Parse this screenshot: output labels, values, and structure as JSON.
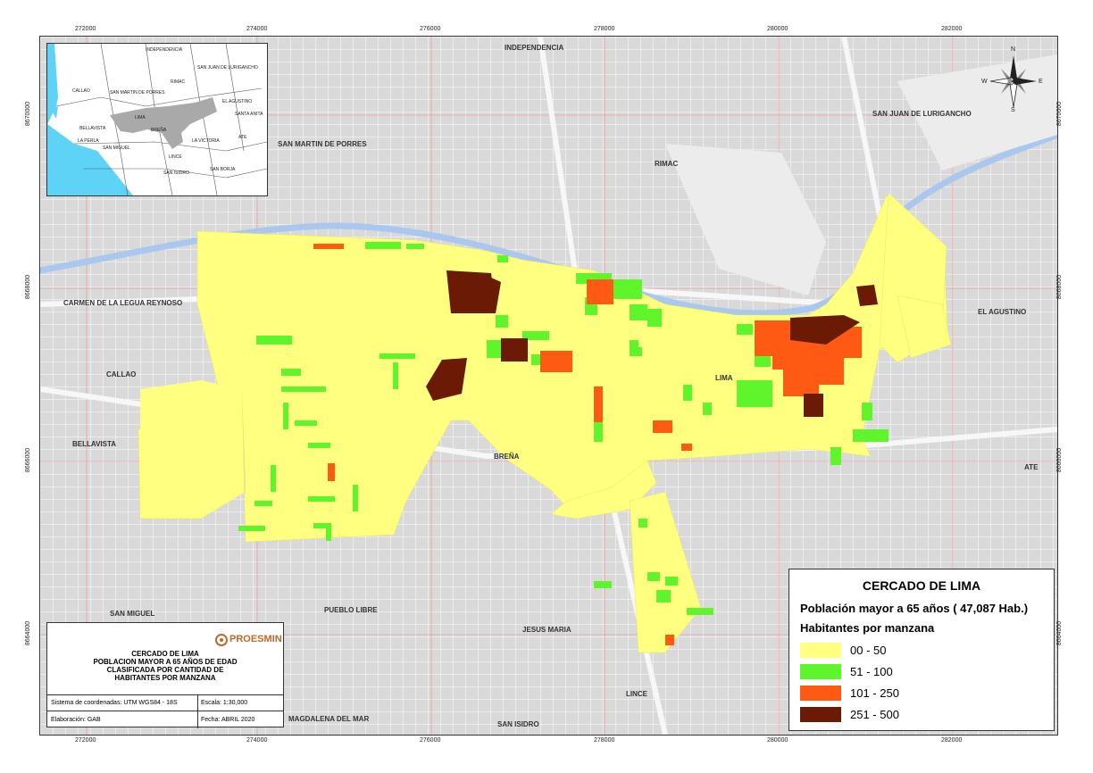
{
  "map": {
    "x_ticks": [
      "272000",
      "274000",
      "276000",
      "278000",
      "280000",
      "282000"
    ],
    "y_ticks": [
      "8670000",
      "8668000",
      "8666000",
      "8664000"
    ],
    "districts": [
      {
        "id": "independencia",
        "name": "INDEPENDENCIA"
      },
      {
        "id": "smp",
        "name": "SAN MARTIN DE PORRES"
      },
      {
        "id": "rimac",
        "name": "RIMAC"
      },
      {
        "id": "sjl",
        "name": "SAN JUAN DE LURIGANCHO"
      },
      {
        "id": "carmen",
        "name": "CARMEN DE LA LEGUA REYNOSO"
      },
      {
        "id": "callao",
        "name": "CALLAO"
      },
      {
        "id": "bellavista",
        "name": "BELLAVISTA"
      },
      {
        "id": "brena",
        "name": "BREÑA"
      },
      {
        "id": "lima",
        "name": "LIMA"
      },
      {
        "id": "agustino",
        "name": "EL AGUSTINO"
      },
      {
        "id": "ate",
        "name": "ATE"
      },
      {
        "id": "sanmiguel",
        "name": "SAN MIGUEL"
      },
      {
        "id": "pueblolibre",
        "name": "PUEBLO LIBRE"
      },
      {
        "id": "jesusmaria",
        "name": "JESUS MARIA"
      },
      {
        "id": "lince",
        "name": "LINCE"
      },
      {
        "id": "magdalena",
        "name": "MAGDALENA DEL MAR"
      },
      {
        "id": "sanisidro",
        "name": "SAN ISIDRO"
      }
    ]
  },
  "inset": {
    "labels": [
      "INDEPENDENCIA",
      "SAN JUAN DE LURIGANCHO",
      "CALLAO",
      "SAN MARTIN DE PORRES",
      "RIMAC",
      "EL AGUSTINO",
      "LIMA",
      "SANTA ANITA",
      "BELLAVISTA",
      "BREÑA",
      "LA VICTORIA",
      "LA PERLA",
      "SAN MIGUEL",
      "ATE",
      "LINCE",
      "SAN ISIDRO",
      "SAN BORJA"
    ]
  },
  "legend": {
    "title": "CERCADO DE LIMA",
    "subtitle": "Población mayor a 65 años ( 47,087 Hab.)",
    "heading": "Habitantes por manzana",
    "classes": [
      {
        "label": "00 - 50",
        "color": "#ffff80"
      },
      {
        "label": "51 - 100",
        "color": "#5ef52a"
      },
      {
        "label": "101 - 250",
        "color": "#ff5a14"
      },
      {
        "label": "251 - 500",
        "color": "#6b1a06"
      }
    ]
  },
  "title_block": {
    "logo": "PROESMIN",
    "title_lines": [
      "CERCADO DE LIMA",
      "POBLACION MAYOR A 65 AÑOS DE EDAD",
      "CLASIFICADA POR CANTIDAD DE",
      "HABITANTES POR MANZANA"
    ],
    "coord_system": "Sistema de coordenadas: UTM WGS84 - 18S",
    "scale": "Escala:     1:30,000",
    "author": "Elaboración:  GAB",
    "date": "Fecha: ABRIL 2020"
  },
  "north_arrow": {
    "n": "N",
    "s": "S",
    "e": "E",
    "w": "W"
  }
}
